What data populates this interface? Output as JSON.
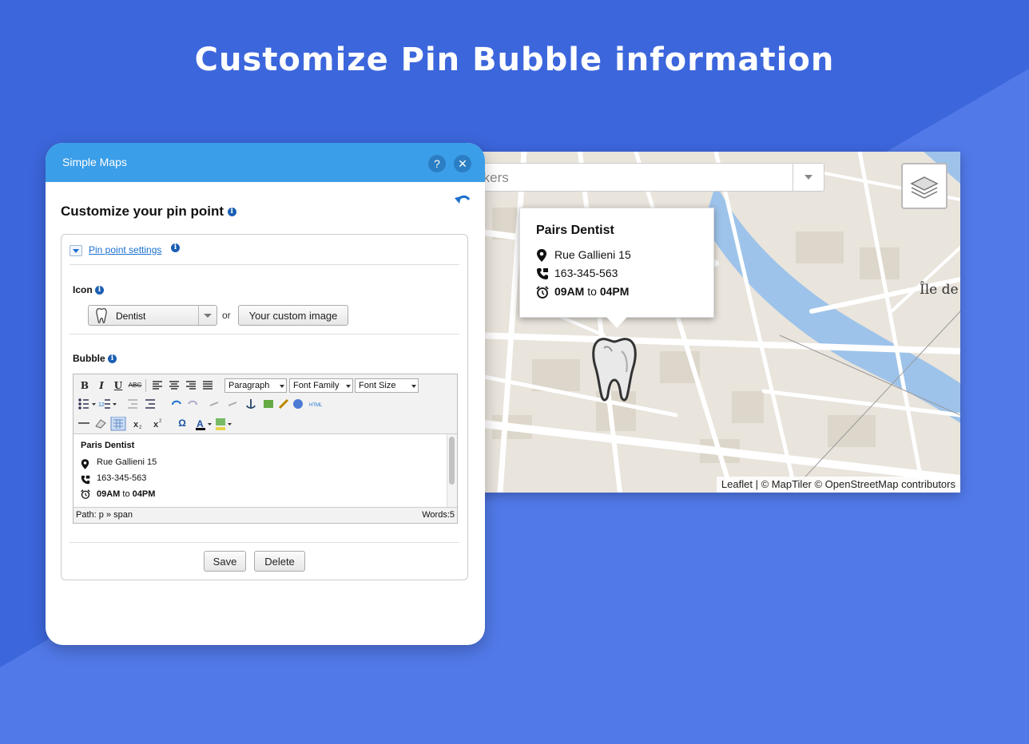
{
  "headline": "Customize Pin Bubble information",
  "colors": {
    "background": "#4a73e2",
    "dialog_header": "#3b9ee8",
    "link": "#1a6fcf"
  },
  "map": {
    "search_placeholder": "rkers",
    "layers_icon": "layers-icon",
    "place_label": "Île de",
    "popup": {
      "title": "Pairs Dentist",
      "address": "Rue Gallieni 15",
      "phone": "163-345-563",
      "hours_open": "09AM",
      "hours_to": "to",
      "hours_close": "04PM"
    },
    "marker_icon": "tooth-icon",
    "attribution": {
      "leaflet": "Leaflet",
      "separator": "|",
      "rest": "© MapTiler © OpenStreetMap contributors"
    }
  },
  "dialog": {
    "title": "Simple Maps",
    "help_label": "?",
    "close_label": "✕",
    "heading": "Customize your pin point",
    "section_link": "Pin point settings",
    "icon_label": "Icon",
    "icon_select_value": "Dentist",
    "or_text": "or",
    "custom_image_button": "Your custom image",
    "bubble_label": "Bubble",
    "toolbar": {
      "paragraph": "Paragraph",
      "font_family": "Font Family",
      "font_size": "Font Size",
      "bold": "B",
      "italic": "I",
      "underline": "U",
      "strike": "ABC",
      "omega": "Ω",
      "html": "HTML"
    },
    "editor": {
      "title": "Paris Dentist",
      "address": "Rue Gallieni 15",
      "phone": "163-345-563",
      "hours_open": "09AM",
      "hours_to": "to",
      "hours_close": "04PM"
    },
    "status_path": "Path: p » span",
    "status_words": "Words:5",
    "save_button": "Save",
    "delete_button": "Delete"
  }
}
